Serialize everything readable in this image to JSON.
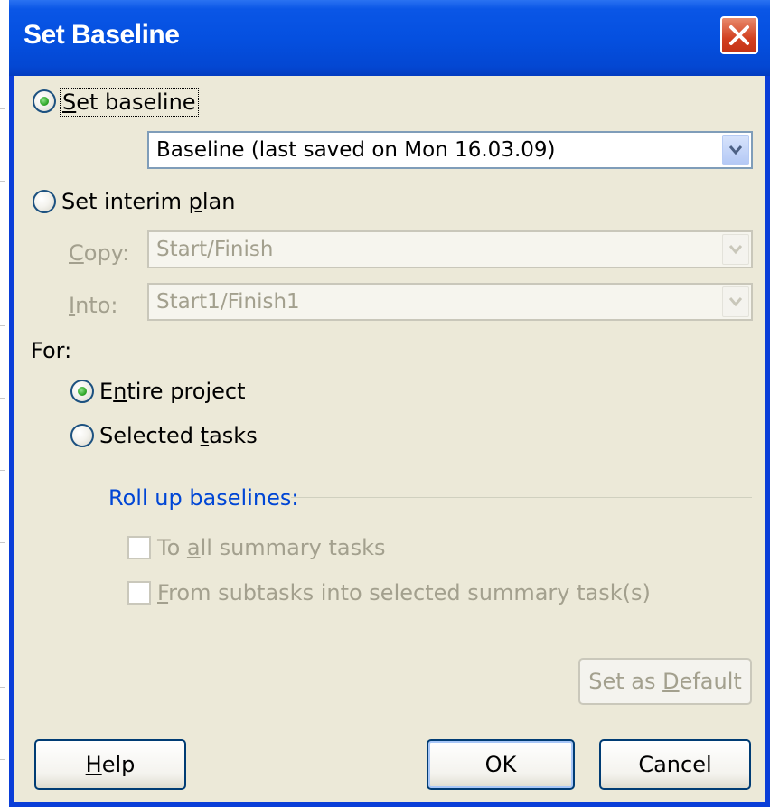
{
  "window": {
    "title": "Set Baseline",
    "close_icon": "close-icon"
  },
  "set_baseline": {
    "label_u": "S",
    "label_rest": "et baseline",
    "selected": true,
    "baseline_select": "Baseline (last saved on Mon 16.03.09)"
  },
  "set_interim_plan": {
    "label_pre": "Set interim ",
    "label_u": "p",
    "label_rest": "lan",
    "selected": false,
    "copy_label_u": "C",
    "copy_label_rest": "opy:",
    "copy_value": "Start/Finish",
    "into_label_u": "I",
    "into_label_rest": "nto:",
    "into_value": "Start1/Finish1"
  },
  "for": {
    "label": "For:",
    "entire_project_pre": "E",
    "entire_project_u": "n",
    "entire_project_rest": "tire project",
    "selected_tasks_pre": "Selected ",
    "selected_tasks_u": "t",
    "selected_tasks_rest": "asks"
  },
  "rollup": {
    "label": "Roll up baselines:",
    "to_all_pre": "To ",
    "to_all_u": "a",
    "to_all_rest": "ll summary tasks",
    "from_sub_u": "F",
    "from_sub_rest": "rom subtasks into selected summary task(s)"
  },
  "buttons": {
    "set_default_pre": "Set as ",
    "set_default_u": "D",
    "set_default_rest": "efault",
    "help_u": "H",
    "help_rest": "elp",
    "ok": "OK",
    "cancel": "Cancel"
  },
  "colors": {
    "titlebar": "#0550e0",
    "dialog_bg": "#ece9d8",
    "group_label": "#0046d5",
    "disabled_text": "#a3a08e"
  }
}
